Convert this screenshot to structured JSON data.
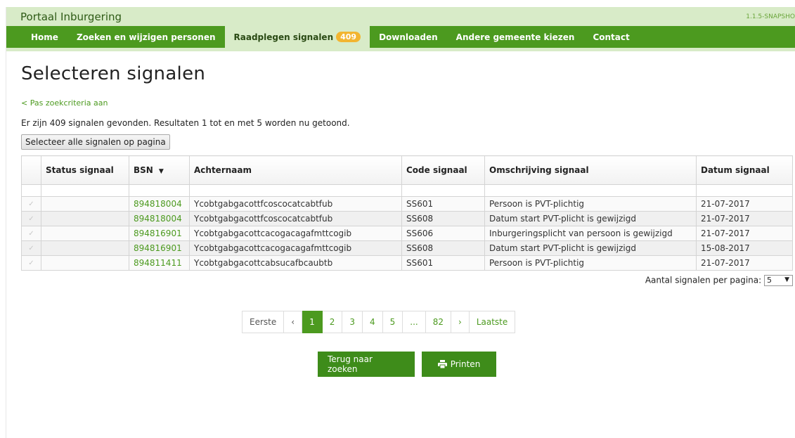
{
  "app": {
    "title": "Portaal Inburgering",
    "version": "1.1.5-SNAPSHO"
  },
  "nav": {
    "home": "Home",
    "zoeken": "Zoeken en wijzigen personen",
    "raadplegen": "Raadplegen signalen",
    "raadplegen_badge": "409",
    "downloaden": "Downloaden",
    "gemeente": "Andere gemeente kiezen",
    "contact": "Contact"
  },
  "page": {
    "title": "Selecteren signalen",
    "back_link": "< Pas zoekcriteria aan",
    "result_text": "Er zijn 409 signalen gevonden. Resultaten 1 tot en met 5 worden nu getoond.",
    "select_all": "Selecteer alle signalen op pagina"
  },
  "table": {
    "headers": {
      "status": "Status signaal",
      "bsn": "BSN",
      "achternaam": "Achternaam",
      "code": "Code signaal",
      "omschrijving": "Omschrijving signaal",
      "datum": "Datum signaal"
    },
    "rows": [
      {
        "status": "",
        "bsn": "894818004",
        "achternaam": "Ycobtgabgacottfcoscocatcabtfub",
        "code": "SS601",
        "omschrijving": "Persoon is PVT-plichtig",
        "datum": "21-07-2017"
      },
      {
        "status": "",
        "bsn": "894818004",
        "achternaam": "Ycobtgabgacottfcoscocatcabtfub",
        "code": "SS608",
        "omschrijving": "Datum start PVT-plicht is gewijzigd",
        "datum": "21-07-2017"
      },
      {
        "status": "",
        "bsn": "894816901",
        "achternaam": "Ycobtgabgacottcacogacagafmttcogib",
        "code": "SS606",
        "omschrijving": "Inburgeringsplicht van persoon is gewijzigd",
        "datum": "21-07-2017"
      },
      {
        "status": "",
        "bsn": "894816901",
        "achternaam": "Ycobtgabgacottcacogacagafmttcogib",
        "code": "SS608",
        "omschrijving": "Datum start PVT-plicht is gewijzigd",
        "datum": "15-08-2017"
      },
      {
        "status": "",
        "bsn": "894811411",
        "achternaam": "Ycobtgabgacottcabsucafbcaubtb",
        "code": "SS601",
        "omschrijving": "Persoon is PVT-plichtig",
        "datum": "21-07-2017"
      }
    ]
  },
  "perpage": {
    "label": "Aantal signalen per pagina:",
    "value": "5"
  },
  "pagination": {
    "first": "Eerste",
    "prev": "‹",
    "pages": [
      "1",
      "2",
      "3",
      "4",
      "5"
    ],
    "ellipsis": "...",
    "last_page": "82",
    "next": "›",
    "last": "Laatste"
  },
  "actions": {
    "back": "Terug naar zoeken",
    "print": "Printen"
  },
  "colors": {
    "brand_green": "#4c9a1f",
    "light_green": "#d8ebc8",
    "badge": "#f2b531"
  }
}
